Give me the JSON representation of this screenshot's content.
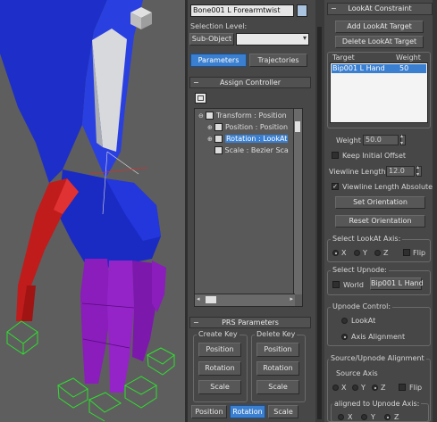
{
  "colors": {
    "accent": "#3a7fd0",
    "panel": "#474747",
    "viewport": "#5e5e5e",
    "hand_blue": "#1a2ccf",
    "finger_red": "#c81e1e",
    "finger_purple": "#8c1fbf",
    "gizmo_green": "#2ee02e"
  },
  "object": {
    "name": "Bone001 L Forearmtwist",
    "color_swatch": "#aac4e0"
  },
  "selection": {
    "label": "Selection Level:",
    "subobject_button": "Sub-Object",
    "dropdown_value": ""
  },
  "tabs": {
    "parameters": "Parameters",
    "trajectories": "Trajectories"
  },
  "assign_controller": {
    "title": "Assign Controller",
    "icon": "assign-controller-icon",
    "tree": [
      {
        "label": "Transform : Position",
        "icon": "transform-icon",
        "selected": false
      },
      {
        "label": "Position : Position",
        "icon": "position-icon",
        "selected": false
      },
      {
        "label": "Rotation : LookAt",
        "icon": "rotation-icon",
        "selected": true
      },
      {
        "label": "Scale : Bezier Sca",
        "icon": "scale-icon",
        "selected": false
      }
    ]
  },
  "prs": {
    "title": "PRS Parameters",
    "create_key": {
      "title": "Create Key",
      "position": "Position",
      "rotation": "Rotation",
      "scale": "Scale"
    },
    "delete_key": {
      "title": "Delete Key",
      "position": "Position",
      "rotation": "Rotation",
      "scale": "Scale"
    },
    "bottom_tabs": {
      "position": "Position",
      "rotation": "Rotation",
      "scale": "Scale",
      "active": "Rotation"
    }
  },
  "lookat": {
    "title": "LookAt Constraint",
    "add_target": "Add LookAt Target",
    "delete_target": "Delete LookAt Target",
    "list_headers": {
      "target": "Target",
      "weight": "Weight"
    },
    "targets": [
      {
        "name": "Bip001 L Hand",
        "weight": "50"
      }
    ],
    "weight_label": "Weight",
    "weight_value": "50.0",
    "keep_offset": "Keep Initial Offset",
    "keep_offset_checked": false,
    "viewline_label": "Viewline Length",
    "viewline_value": "12.0",
    "viewline_absolute": "Viewline Length Absolute",
    "viewline_absolute_checked": true,
    "set_orientation": "Set Orientation",
    "reset_orientation": "Reset Orientation",
    "select_axis": {
      "title": "Select LookAt Axis:",
      "x": "X",
      "y": "Y",
      "z": "Z",
      "selected": "X",
      "flip": "Flip",
      "flip_checked": false
    },
    "select_upnode": {
      "title": "Select Upnode:",
      "world": "World",
      "world_checked": false,
      "node": "Bip001 L Hand"
    },
    "upnode_control": {
      "title": "Upnode Control:",
      "lookat": "LookAt",
      "axis_alignment": "Axis Alignment",
      "selected": "Axis Alignment"
    },
    "source_upnode": {
      "title": "Source/Upnode Alignment",
      "source_axis": "Source Axis",
      "x": "X",
      "y": "Y",
      "z": "Z",
      "source_selected": "Z",
      "flip": "Flip",
      "flip_checked": false,
      "aligned_to": "aligned to Upnode Axis:",
      "ax": "X",
      "ay": "Y",
      "az": "Z",
      "aligned_selected": "Z"
    }
  }
}
